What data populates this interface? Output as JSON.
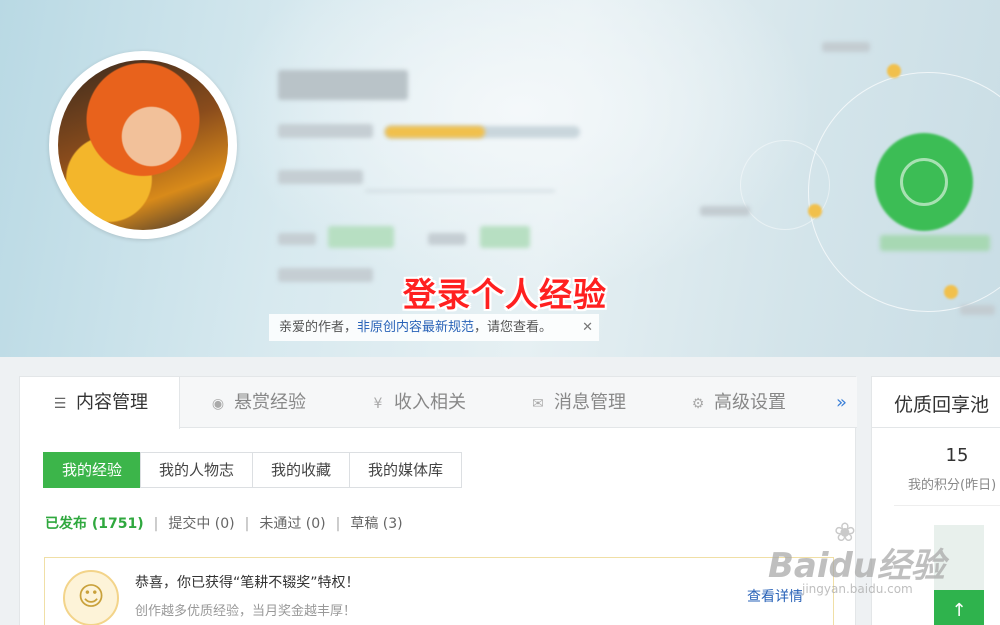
{
  "banner": {
    "overlay_title": "登录个人经验",
    "notice": {
      "prefix": "亲爱的作者，",
      "link": "非原创内容最新规范",
      "suffix": "，请您查看。",
      "close": "✕"
    }
  },
  "tabs": [
    {
      "label": "内容管理",
      "icon": "list-icon",
      "glyph": "☰",
      "active": true
    },
    {
      "label": "悬赏经验",
      "icon": "reward-icon",
      "glyph": "◉",
      "active": false
    },
    {
      "label": "收入相关",
      "icon": "yen-icon",
      "glyph": "¥",
      "active": false
    },
    {
      "label": "消息管理",
      "icon": "mail-icon",
      "glyph": "✉",
      "active": false
    },
    {
      "label": "高级设置",
      "icon": "gear-icon",
      "glyph": "⚙",
      "active": false
    }
  ],
  "tabs_more": "»",
  "subtabs": [
    {
      "label": "我的经验",
      "active": true
    },
    {
      "label": "我的人物志",
      "active": false
    },
    {
      "label": "我的收藏",
      "active": false
    },
    {
      "label": "我的媒体库",
      "active": false
    }
  ],
  "filters": [
    {
      "label": "已发布 (1751)",
      "active": true
    },
    {
      "label": "提交中 (0)",
      "active": false
    },
    {
      "label": "未通过 (0)",
      "active": false
    },
    {
      "label": "草稿 (3)",
      "active": false
    }
  ],
  "filter_separator": "|",
  "award": {
    "title": "恭喜，你已获得“笔耕不辍奖”特权！",
    "subtitle": "创作越多优质经验，当月奖金越丰厚！",
    "link": "查看详情",
    "icon": "trophy-person-icon"
  },
  "side": {
    "title": "优质回享池",
    "score": "15",
    "score_label": "我的积分(昨日)",
    "button_glyph": "↑"
  },
  "watermark": {
    "main": "Baidu经验",
    "sub": "jingyan.baidu.com",
    "paw": "❀"
  },
  "colors": {
    "accent_green": "#3cb54a",
    "link_blue": "#2a63b8",
    "overlay_red": "#ff2020"
  }
}
